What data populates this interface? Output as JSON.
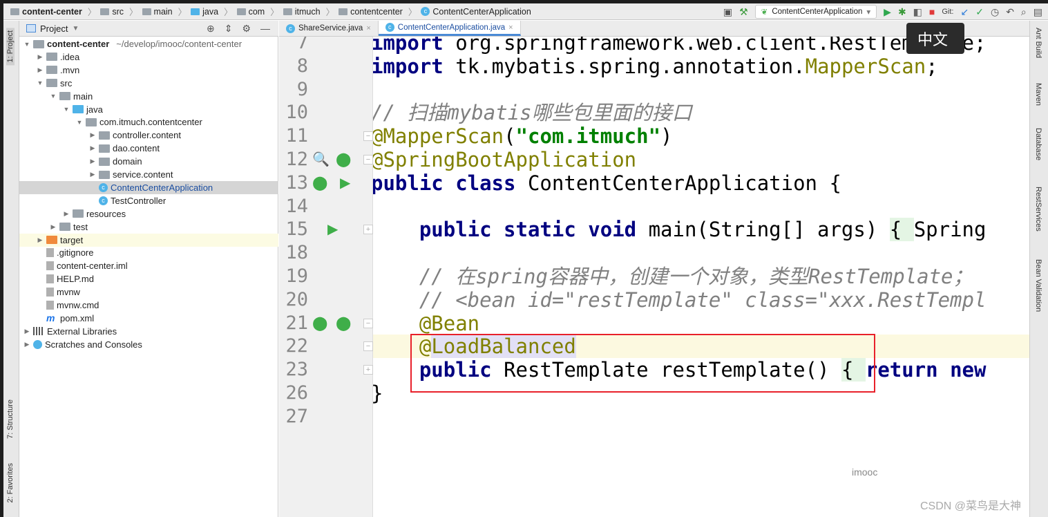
{
  "breadcrumb": [
    "content-center",
    "src",
    "main",
    "java",
    "com",
    "itmuch",
    "contentcenter",
    "ContentCenterApplication"
  ],
  "toolbar": {
    "run_config": "ContentCenterApplication",
    "git_label": "Git:"
  },
  "left_strip": {
    "project": "1: Project",
    "structure": "7: Structure",
    "favorites": "2: Favorites"
  },
  "project_panel": {
    "title": "Project",
    "tree": [
      {
        "label": "content-center",
        "path": "~/develop/imooc/content-center",
        "depth": 0,
        "arrow": "down",
        "icon": "module",
        "bold": true
      },
      {
        "label": ".idea",
        "depth": 1,
        "arrow": "right",
        "icon": "folder"
      },
      {
        "label": ".mvn",
        "depth": 1,
        "arrow": "right",
        "icon": "folder"
      },
      {
        "label": "src",
        "depth": 1,
        "arrow": "down",
        "icon": "folder"
      },
      {
        "label": "main",
        "depth": 2,
        "arrow": "down",
        "icon": "folder"
      },
      {
        "label": "java",
        "depth": 3,
        "arrow": "down",
        "icon": "source-folder"
      },
      {
        "label": "com.itmuch.contentcenter",
        "depth": 4,
        "arrow": "down",
        "icon": "package"
      },
      {
        "label": "controller.content",
        "depth": 5,
        "arrow": "right",
        "icon": "package"
      },
      {
        "label": "dao.content",
        "depth": 5,
        "arrow": "right",
        "icon": "package"
      },
      {
        "label": "domain",
        "depth": 5,
        "arrow": "right",
        "icon": "package"
      },
      {
        "label": "service.content",
        "depth": 5,
        "arrow": "right",
        "icon": "package"
      },
      {
        "label": "ContentCenterApplication",
        "depth": 5,
        "arrow": "none",
        "icon": "spring-class",
        "selected": true
      },
      {
        "label": "TestController",
        "depth": 5,
        "arrow": "none",
        "icon": "class"
      },
      {
        "label": "resources",
        "depth": 3,
        "arrow": "right",
        "icon": "folder"
      },
      {
        "label": "test",
        "depth": 2,
        "arrow": "right",
        "icon": "folder"
      },
      {
        "label": "target",
        "depth": 1,
        "arrow": "right",
        "icon": "excluded-folder",
        "highlight": true
      },
      {
        "label": ".gitignore",
        "depth": 1,
        "arrow": "none",
        "icon": "file"
      },
      {
        "label": "content-center.iml",
        "depth": 1,
        "arrow": "none",
        "icon": "file"
      },
      {
        "label": "HELP.md",
        "depth": 1,
        "arrow": "none",
        "icon": "file"
      },
      {
        "label": "mvnw",
        "depth": 1,
        "arrow": "none",
        "icon": "file"
      },
      {
        "label": "mvnw.cmd",
        "depth": 1,
        "arrow": "none",
        "icon": "file"
      },
      {
        "label": "pom.xml",
        "depth": 1,
        "arrow": "none",
        "icon": "maven"
      },
      {
        "label": "External Libraries",
        "depth": 0,
        "arrow": "right",
        "icon": "library"
      },
      {
        "label": "Scratches and Consoles",
        "depth": 0,
        "arrow": "right",
        "icon": "scratch"
      }
    ]
  },
  "tabs": [
    {
      "label": "ShareService.java",
      "active": false
    },
    {
      "label": "ContentCenterApplication.java",
      "active": true
    }
  ],
  "code": [
    {
      "n": "7",
      "tokens": [
        [
          "kw",
          "import"
        ],
        [
          "tx",
          " org.springframework.web.client.RestTemplate;"
        ]
      ]
    },
    {
      "n": "8",
      "tokens": [
        [
          "kw",
          "import"
        ],
        [
          "tx",
          " tk.mybatis.spring.annotation."
        ],
        [
          "an",
          "MapperScan"
        ],
        [
          "tx",
          ";"
        ]
      ]
    },
    {
      "n": "9",
      "tokens": []
    },
    {
      "n": "10",
      "tokens": [
        [
          "cm",
          "// 扫描mybatis哪些包里面的接口"
        ]
      ]
    },
    {
      "n": "11",
      "tokens": [
        [
          "an",
          "@MapperScan"
        ],
        [
          "tx",
          "("
        ],
        [
          "str",
          "\"com.itmuch\""
        ],
        [
          "tx",
          ")"
        ]
      ]
    },
    {
      "n": "12",
      "tokens": [
        [
          "an",
          "@SpringBootApplication"
        ]
      ]
    },
    {
      "n": "13",
      "tokens": [
        [
          "kw",
          "public class"
        ],
        [
          "tx",
          " ContentCenterApplication {"
        ]
      ]
    },
    {
      "n": "14",
      "tokens": []
    },
    {
      "n": "15",
      "tokens": [
        [
          "tx",
          "    "
        ],
        [
          "kw",
          "public static void"
        ],
        [
          "tx",
          " main(String[] args) "
        ],
        [
          "br",
          "{ "
        ],
        [
          "tx",
          "Spring"
        ]
      ]
    },
    {
      "n": "18",
      "tokens": []
    },
    {
      "n": "19",
      "tokens": [
        [
          "tx",
          "    "
        ],
        [
          "cm",
          "// 在spring容器中，创建一个对象，类型RestTemplate；"
        ]
      ]
    },
    {
      "n": "20",
      "tokens": [
        [
          "tx",
          "    "
        ],
        [
          "cm",
          "// <bean id=\"restTemplate\" class=\"xxx.RestTempl"
        ]
      ]
    },
    {
      "n": "21",
      "tokens": [
        [
          "tx",
          "    "
        ],
        [
          "an",
          "@Bean"
        ]
      ]
    },
    {
      "n": "22",
      "tokens": [
        [
          "tx",
          "    "
        ],
        [
          "an",
          "@"
        ],
        [
          "sel",
          "LoadBalanced"
        ]
      ],
      "current": true
    },
    {
      "n": "23",
      "tokens": [
        [
          "tx",
          "    "
        ],
        [
          "kw",
          "public"
        ],
        [
          "tx",
          " RestTemplate restTemplate() "
        ],
        [
          "br",
          "{ "
        ],
        [
          "kw",
          "return new"
        ]
      ]
    },
    {
      "n": "26",
      "tokens": [
        [
          "tx",
          "}"
        ]
      ]
    },
    {
      "n": "27",
      "tokens": []
    }
  ],
  "right_strip": [
    "Ant Build",
    "Maven",
    "Database",
    "RestServices",
    "Bean Validation"
  ],
  "tooltip": "中文",
  "watermarks": {
    "imooc": "imooc",
    "csdn": "CSDN @菜鸟是大神"
  },
  "colors": {
    "keyword": "#000080",
    "annotation": "#808000",
    "string": "#008000",
    "comment": "#808080",
    "highlight_box": "#e8202a"
  }
}
